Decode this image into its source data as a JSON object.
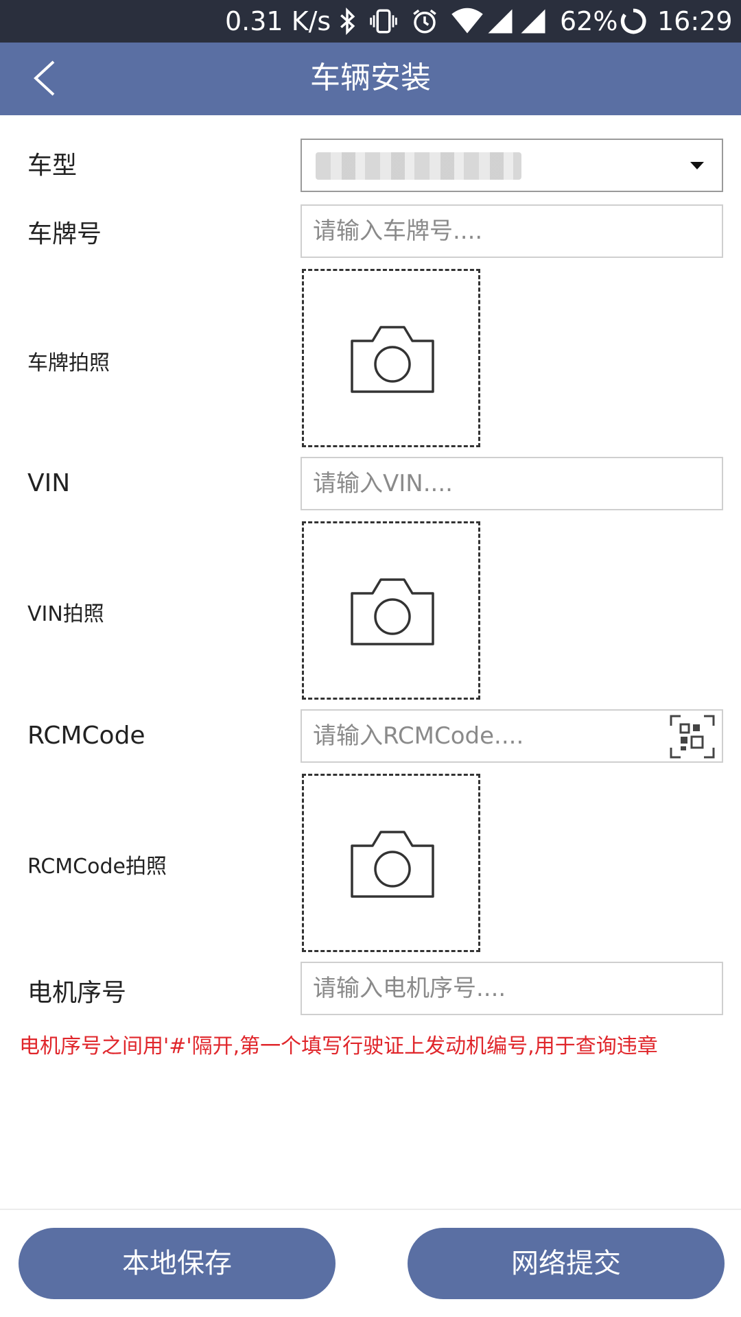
{
  "status_bar": {
    "net_speed": "0.31 K/s",
    "battery": "62%",
    "time": "16:29"
  },
  "header": {
    "title": "车辆安装"
  },
  "form": {
    "vehicle_type_label": "车型",
    "plate_label": "车牌号",
    "plate_placeholder": "请输入车牌号....",
    "plate_photo_label": "车牌拍照",
    "vin_label": "VIN",
    "vin_placeholder": "请输入VIN....",
    "vin_photo_label": "VIN拍照",
    "rcm_label": "RCMCode",
    "rcm_placeholder": "请输入RCMCode....",
    "rcm_photo_label": "RCMCode拍照",
    "motor_label": "电机序号",
    "motor_placeholder": "请输入电机序号....",
    "hint": "电机序号之间用'#'隔开,第一个填写行驶证上发动机编号,用于查询违章"
  },
  "actions": {
    "save_local": "本地保存",
    "submit_network": "网络提交"
  },
  "colors": {
    "accent": "#5a6fa3",
    "status_bar": "#2a2f3d",
    "hint": "#e0262b"
  },
  "icons": [
    "back-icon",
    "bluetooth-icon",
    "vibrate-icon",
    "alarm-icon",
    "wifi-icon",
    "signal-icon",
    "loading-icon",
    "camera-icon",
    "qr-scan-icon",
    "dropdown-caret-icon"
  ]
}
